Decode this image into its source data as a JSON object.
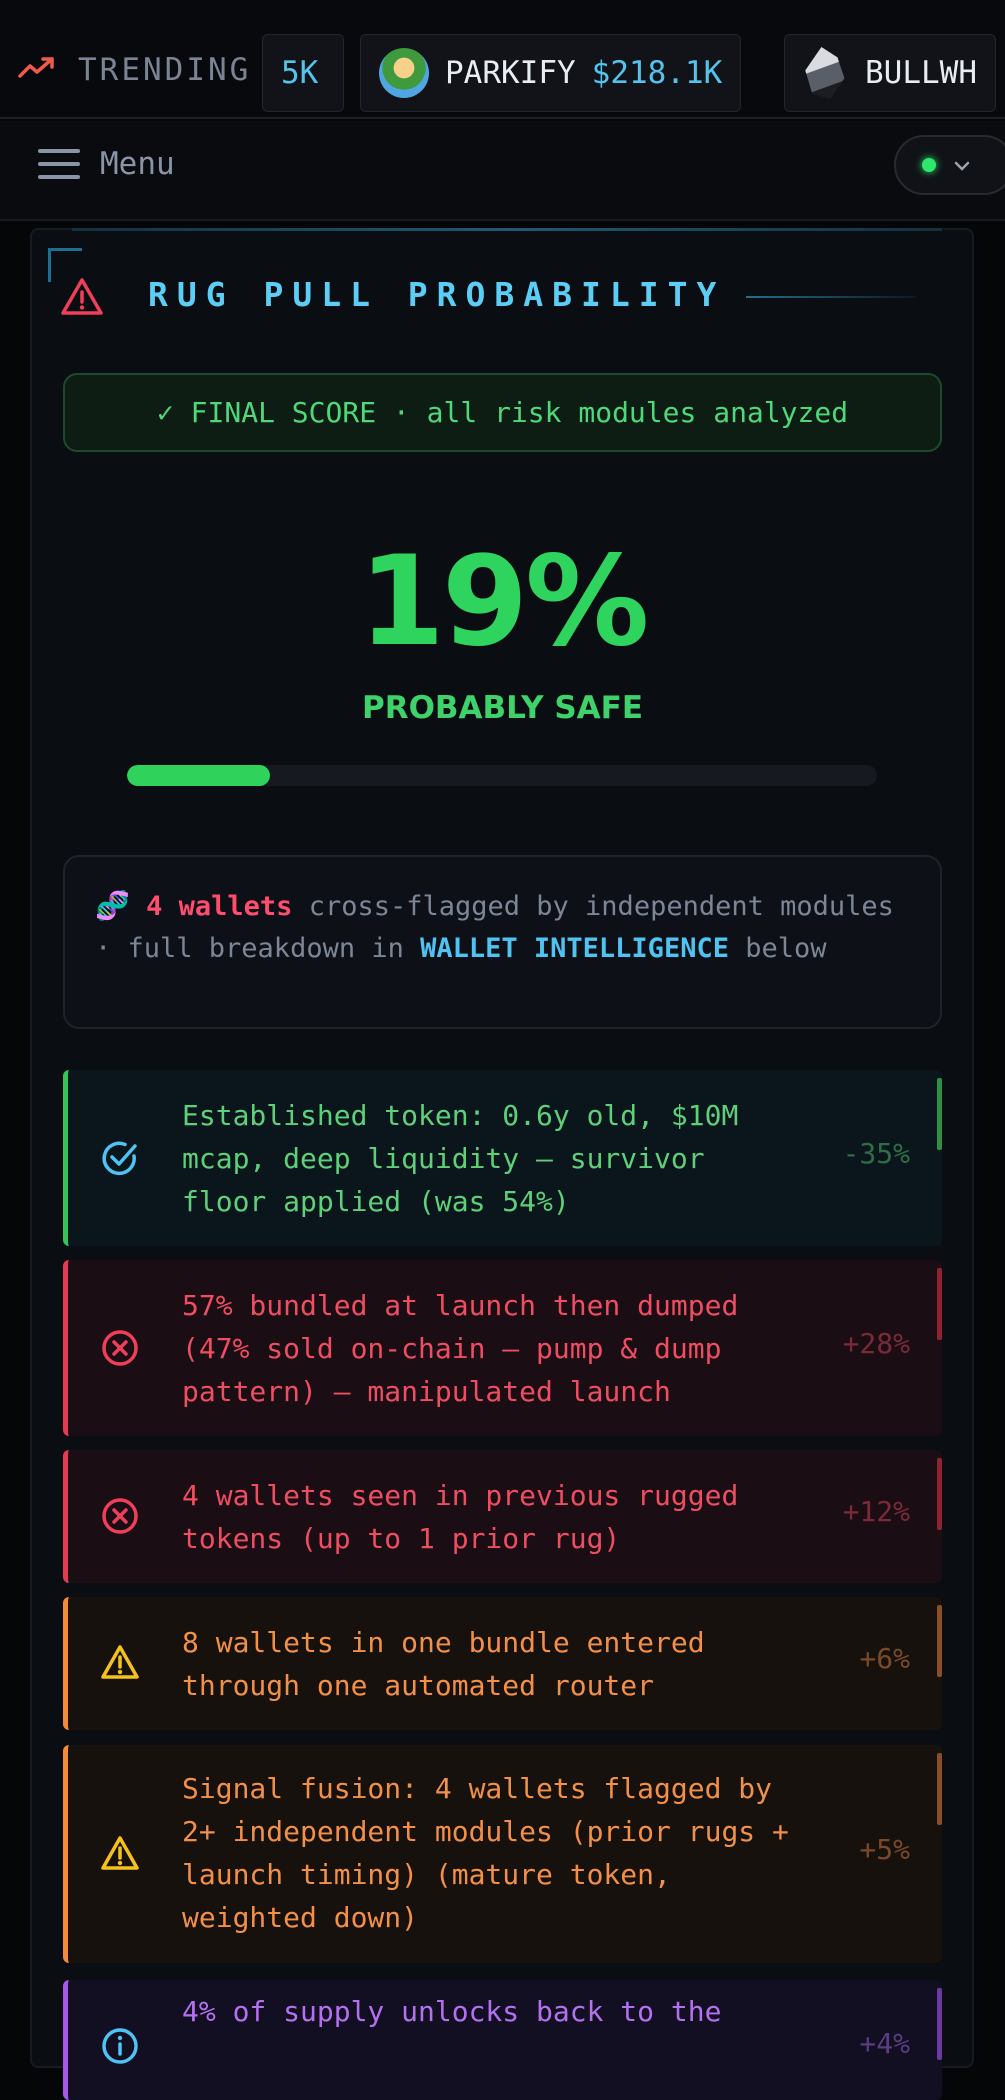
{
  "ticker": {
    "label": "TRENDING",
    "partial_price": "5K",
    "items": [
      {
        "name": "PARKIFY",
        "price": "$218.1K"
      },
      {
        "name": "BULLWH",
        "price": ""
      }
    ]
  },
  "header": {
    "menu_label": "Menu",
    "status_color": "#2ee86a"
  },
  "card": {
    "title": "RUG PULL PROBABILITY",
    "final_score_banner": "✓ FINAL SCORE · all risk modules analyzed",
    "score": "19%",
    "score_value": 0.19,
    "verdict": "PROBABLY SAFE",
    "notice": {
      "count": "4 wallets",
      "text_1": " cross-flagged by independent modules · full breakdown in ",
      "highlight": "WALLET INTELLIGENCE",
      "text_2": " below"
    },
    "factors": [
      {
        "type": "safe",
        "icon": "check-circle-icon",
        "text": "Established token: 0.6y old, $10M mcap, deep liquidity — survivor floor applied (was 54%)",
        "value": "-35%"
      },
      {
        "type": "danger",
        "icon": "x-circle-icon",
        "text": "57% bundled at launch then dumped (47% sold on-chain — pump & dump pattern) — manipulated launch",
        "value": "+28%"
      },
      {
        "type": "danger",
        "icon": "x-circle-icon",
        "text": "4 wallets seen in previous rugged tokens (up to 1 prior rug)",
        "value": "+12%"
      },
      {
        "type": "warning",
        "icon": "warning-triangle-icon",
        "text": "8 wallets in one bundle entered through one automated router",
        "value": "+6%"
      },
      {
        "type": "warning",
        "icon": "warning-triangle-icon",
        "text": "Signal fusion: 4 wallets flagged by 2+ independent modules (prior rugs + launch timing) (mature token, weighted down)",
        "value": "+5%"
      },
      {
        "type": "info",
        "icon": "info-circle-icon",
        "text": "4% of supply unlocks back to the",
        "value": "+4%"
      }
    ]
  }
}
